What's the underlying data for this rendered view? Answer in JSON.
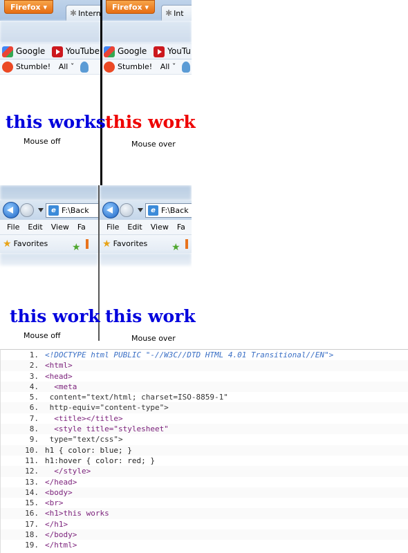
{
  "firefox": {
    "menu_label": "Firefox",
    "tab_left": "Intern",
    "tab_right": "Int",
    "bookmarks_left": [
      "Google",
      "YouTube"
    ],
    "bookmarks_right": [
      "Google",
      "YouTube"
    ],
    "stumble_left": [
      "Stumble!",
      "All ˇ"
    ],
    "stumble_right": [
      "Stumble!",
      "All ˇ"
    ],
    "heading_left": "this works",
    "heading_right": "this work",
    "caption_left": "Mouse off",
    "caption_right": "Mouse over"
  },
  "ie": {
    "address_left": "F:\\Back",
    "address_right": "F:\\Back",
    "menu_left": [
      "File",
      "Edit",
      "View",
      "Fa"
    ],
    "menu_right": [
      "File",
      "Edit",
      "View",
      "Fa"
    ],
    "favorites_label": "Favorites",
    "heading_left": "this work",
    "heading_right": "this work",
    "caption_left": "Mouse off",
    "caption_right": "Mouse over"
  },
  "colors": {
    "normal_heading": "#0000dd",
    "hover_heading": "#ee0000"
  },
  "code": {
    "lines": [
      {
        "num": "1.",
        "text": "<!DOCTYPE html PUBLIC \"-//W3C//DTD HTML 4.01 Transitional//EN\">",
        "kind": "doc"
      },
      {
        "num": "2.",
        "text": "<html>",
        "kind": "tag"
      },
      {
        "num": "3.",
        "text": "<head>",
        "kind": "tag"
      },
      {
        "num": "4.",
        "text": "  <meta",
        "kind": "tag"
      },
      {
        "num": "5.",
        "text": " content=\"text/html; charset=ISO-8859-1\"",
        "kind": "attr"
      },
      {
        "num": "6.",
        "text": " http-equiv=\"content-type\">",
        "kind": "attr"
      },
      {
        "num": "7.",
        "text": "  <title></title>",
        "kind": "tag"
      },
      {
        "num": "8.",
        "text": "  <style title=\"stylesheet\"",
        "kind": "tag"
      },
      {
        "num": "9.",
        "text": " type=\"text/css\">",
        "kind": "attr"
      },
      {
        "num": "10.",
        "text": "h1 { color: blue; }",
        "kind": "plain"
      },
      {
        "num": "11.",
        "text": "h1:hover { color: red; }",
        "kind": "plain"
      },
      {
        "num": "12.",
        "text": "  </style>",
        "kind": "tag"
      },
      {
        "num": "13.",
        "text": "</head>",
        "kind": "tag"
      },
      {
        "num": "14.",
        "text": "<body>",
        "kind": "tag"
      },
      {
        "num": "15.",
        "text": "<br>",
        "kind": "tag"
      },
      {
        "num": "16.",
        "text": "<h1>this works",
        "kind": "tag"
      },
      {
        "num": "17.",
        "text": "</h1>",
        "kind": "tag"
      },
      {
        "num": "18.",
        "text": "</body>",
        "kind": "tag"
      },
      {
        "num": "19.",
        "text": "</html>",
        "kind": "tag"
      }
    ]
  }
}
